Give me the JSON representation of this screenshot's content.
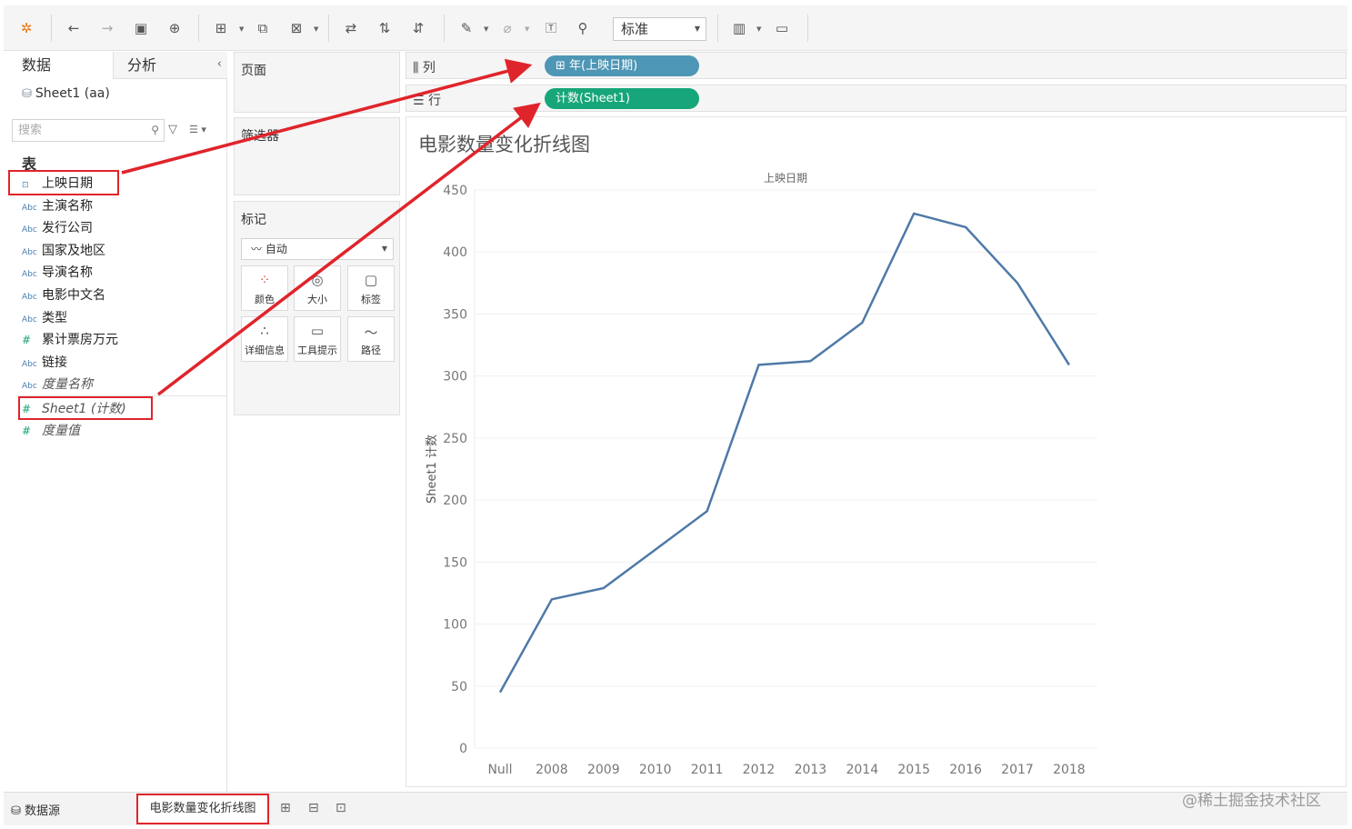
{
  "toolbar": {
    "icons": [
      "tableau-logo-icon",
      "undo-icon",
      "redo-icon",
      "save-icon",
      "new-datasource-icon",
      "new-sheet-icon",
      "duplicate-sheet-icon",
      "clear-sheet-icon",
      "swap-icon",
      "sort-ascending-icon",
      "sort-descending-icon",
      "highlight-icon",
      "group-icon",
      "label-icon",
      "pin-icon",
      "show-cards-icon",
      "presentation-icon"
    ],
    "zoom_value": "标准"
  },
  "data_pane": {
    "tab_data": "数据",
    "tab_analysis": "分析",
    "datasource": "Sheet1 (aa)",
    "search_placeholder": "搜索",
    "tables_heading": "表",
    "fields": [
      {
        "icon": "date-icon",
        "label": "上映日期"
      },
      {
        "icon": "string-icon",
        "label": "主演名称"
      },
      {
        "icon": "string-icon",
        "label": "发行公司"
      },
      {
        "icon": "string-icon",
        "label": "国家及地区"
      },
      {
        "icon": "string-icon",
        "label": "导演名称"
      },
      {
        "icon": "string-icon",
        "label": "电影中文名"
      },
      {
        "icon": "string-icon",
        "label": "类型"
      },
      {
        "icon": "number-icon",
        "label": "累计票房万元"
      },
      {
        "icon": "string-icon",
        "label": "链接"
      },
      {
        "icon": "string-icon",
        "label": "度量名称"
      }
    ],
    "measures": [
      {
        "icon": "number-icon",
        "label": "Sheet1 (计数)"
      },
      {
        "icon": "number-icon",
        "label": "度量值"
      }
    ],
    "icon_text": {
      "string": "Abc",
      "number": "#",
      "date": "⊡"
    }
  },
  "cards": {
    "pages": "页面",
    "filters": "筛选器",
    "marks": "标记",
    "marks_type": "自动",
    "mark_buttons": [
      "颜色",
      "大小",
      "标签",
      "详细信息",
      "工具提示",
      "路径"
    ]
  },
  "shelves": {
    "columns_label": "列",
    "rows_label": "行",
    "columns_pill": "年(上映日期)",
    "rows_pill": "计数(Sheet1)"
  },
  "chart_data": {
    "type": "line",
    "title": "电影数量变化折线图",
    "header": "上映日期",
    "ylabel": "Sheet1 计数",
    "categories": [
      "Null",
      "2008",
      "2009",
      "2010",
      "2011",
      "2012",
      "2013",
      "2014",
      "2015",
      "2016",
      "2017",
      "2018"
    ],
    "values": [
      45,
      120,
      129,
      160,
      191,
      309,
      312,
      343,
      431,
      420,
      375,
      309
    ],
    "ylim": [
      0,
      450
    ],
    "yticks": [
      0,
      50,
      100,
      150,
      200,
      250,
      300,
      350,
      400,
      450
    ],
    "line_color": "#4e79a7",
    "grid": true
  },
  "bottom_tabs": {
    "datasource_tab": "数据源",
    "sheet_tab": "电影数量变化折线图"
  },
  "watermark": "@稀土掘金技术社区",
  "colors": {
    "annotation": "#e0242b",
    "pill_dimension": "#4e96b5",
    "pill_measure": "#17a67a"
  }
}
